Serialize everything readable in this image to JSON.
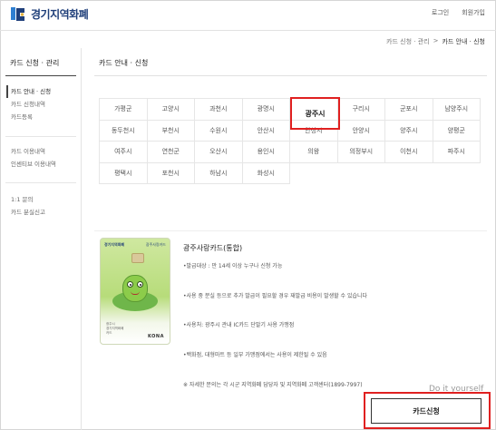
{
  "header": {
    "logo_text": "경기지역화폐",
    "login_label": "로그인",
    "signup_label": "회원가입"
  },
  "breadcrumb": {
    "item1": "카드 신청 · 관리",
    "sep": ">",
    "item2": "카드 안내 · 신청"
  },
  "sidebar": {
    "title": "카드 신청 · 관리",
    "group1": [
      "카드 안내 · 신청",
      "카드 신청내역",
      "카드등록"
    ],
    "group2": [
      "카드 이용내역",
      "인센티브 이용내역"
    ],
    "group3": [
      "1:1 문의",
      "카드 분실신고"
    ]
  },
  "main": {
    "title": "카드 안내 · 신청"
  },
  "cities": {
    "rows": [
      [
        "가평군",
        "고양시",
        "과천시",
        "광명시",
        "광주시",
        "구리시",
        "군포시",
        "남양주시"
      ],
      [
        "동두천시",
        "부천시",
        "수원시",
        "안산시",
        "안성시",
        "안양시",
        "양주시",
        "양평군"
      ],
      [
        "여주시",
        "연천군",
        "오산시",
        "용인시",
        "의왕",
        "의정부시",
        "이천시",
        "파주시"
      ],
      [
        "평택시",
        "포천시",
        "하남시",
        "화성시"
      ]
    ],
    "selected": "광주시"
  },
  "card": {
    "name": "광주사랑카드(통합)",
    "line1": "•발급대상 : 만 14세 이상 누구나 신청 가능",
    "line2": "•사용 중 분실 등으로 추가 발급이 필요할 경우 재발급 비용이 발생할 수 있습니다",
    "line3": "•사용처: 광주시 관내 IC카드 단말기 사용 가맹점",
    "line4": "•백화점, 대형마트 등 일부 가맹점에서는 사용이 제한될 수 있음",
    "line5": "※ 자세한 문의는 각 시군 지역화폐 담당자 및 지역화폐 고객센터(1899-7997)",
    "image_top_left": "경기지역화폐",
    "image_top_right": "광주사랑카드",
    "image_lower": "광주시\n경기지역화폐\n카드",
    "image_brand": "KONA"
  },
  "overlay": {
    "do_it_yourself": "Do it yourself"
  },
  "apply_button": "카드신청",
  "colors": {
    "highlight": "#e02020",
    "brand": "#1f3f7a"
  }
}
